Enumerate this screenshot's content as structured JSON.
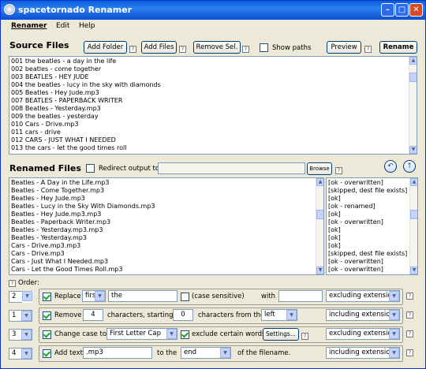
{
  "window": {
    "title": "spacetornado Renamer"
  },
  "menu": [
    "Renamer",
    "Edit",
    "Help"
  ],
  "source": {
    "title": "Source Files",
    "buttons": {
      "add_folder": "Add Folder",
      "add_files": "Add Files",
      "remove_sel": "Remove Sel.",
      "preview": "Preview",
      "rename": "Rename"
    },
    "show_paths": "Show paths",
    "files": [
      "001 the beatles - a day in the life",
      "002 beatles - come together",
      "003 BEATLES - HEY JUDE",
      "004 the beatles - lucy in the sky with diamonds",
      "005 Beatles - Hey Jude.mp3",
      "007 BEATLES - PAPERBACK WRITER",
      "008 Beatles - Yesterday.mp3",
      "009 the beatles - yesterday",
      "010 Cars - Drive.mp3",
      "011 cars - drive",
      "012 CARS - JUST WHAT I NEEDED",
      "013 the cars - let the good times roll"
    ]
  },
  "renamed": {
    "title": "Renamed Files",
    "redirect_label": "Redirect output to:",
    "browse": "Browse",
    "files": [
      "Beatles - A Day in the Life.mp3",
      "Beatles - Come Together.mp3",
      "Beatles - Hey Jude.mp3",
      "Beatles - Lucy in the Sky With Diamonds.mp3",
      "Beatles - Hey Jude.mp3.mp3",
      "Beatles - Paperback Writer.mp3",
      "Beatles - Yesterday.mp3.mp3",
      "Beatles - Yesterday.mp3",
      "Cars - Drive.mp3.mp3",
      "Cars - Drive.mp3",
      "Cars - Just What I Needed.mp3",
      "Cars - Let the Good Times Roll.mp3"
    ],
    "status": [
      "[ok - overwritten]",
      "[skipped, dest file exists]",
      "[ok]",
      "[ok - renamed]",
      "[ok]",
      "[ok - overwritten]",
      "[ok]",
      "[ok]",
      "[ok]",
      "[skipped, dest file exists]",
      "[ok - overwritten]",
      "[ok - overwritten]"
    ]
  },
  "order_label": "Order:",
  "ops": [
    {
      "order": "2",
      "checked": true,
      "parts": {
        "a": "Replace",
        "b": "first",
        "c": "the",
        "d": "(case sensitive)",
        "e": "with",
        "f": "",
        "g": "excluding extension"
      }
    },
    {
      "order": "1",
      "checked": true,
      "parts": {
        "a": "Remove",
        "b": "4",
        "c": "characters, starting",
        "d": "0",
        "e": "characters from the",
        "f": "left",
        "g": "including extension"
      }
    },
    {
      "order": "3",
      "checked": true,
      "parts": {
        "a": "Change case to:",
        "b": "First Letter Cap",
        "c": "exclude certain words.",
        "d": "Settings...",
        "g": "excluding extension"
      }
    },
    {
      "order": "4",
      "checked": true,
      "parts": {
        "a": "Add text",
        "b": ".mp3",
        "c": "to the",
        "d": "end",
        "e": "of the filename.",
        "g": "including extension"
      }
    }
  ],
  "help_glyph": "?"
}
